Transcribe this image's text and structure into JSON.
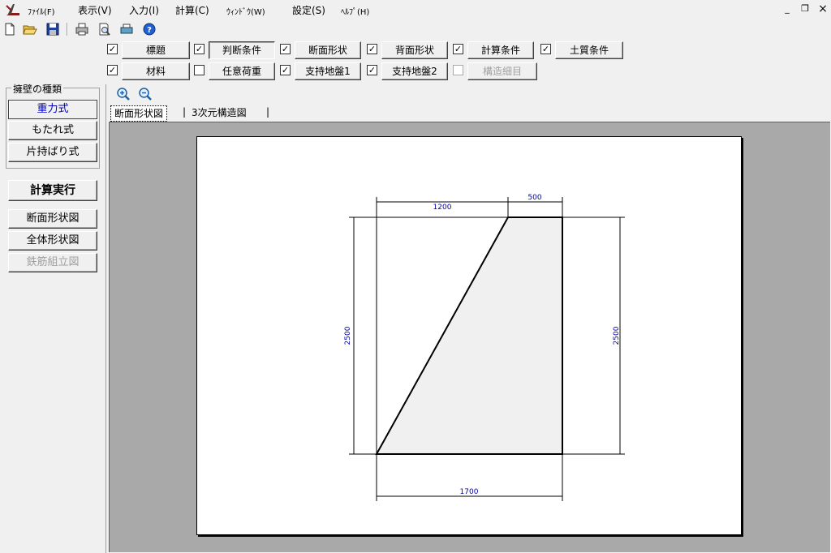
{
  "menu": {
    "file": "ﾌｧｲﾙ(F)",
    "view": "表示(V)",
    "input": "入力(I)",
    "calc": "計算(C)",
    "window": "ｳｨﾝﾄﾞｳ(W)",
    "settings": "設定(S)",
    "help": "ﾍﾙﾌﾟ(H)"
  },
  "window_controls": {
    "minimize": "_",
    "restore": "❐",
    "close": "×"
  },
  "toolbar_icons": [
    "new-file-icon",
    "open-folder-icon",
    "save-icon",
    "print-icon",
    "print-preview-icon",
    "printer-setup-icon",
    "help-icon"
  ],
  "options": {
    "row1": [
      {
        "label": "標題",
        "checked": true
      },
      {
        "label": "判断条件",
        "checked": true,
        "pressed": true
      },
      {
        "label": "断面形状",
        "checked": true
      },
      {
        "label": "背面形状",
        "checked": true
      },
      {
        "label": "計算条件",
        "checked": true
      },
      {
        "label": "土質条件",
        "checked": true
      }
    ],
    "row2": [
      {
        "label": "材料",
        "checked": true
      },
      {
        "label": "任意荷重",
        "checked": false
      },
      {
        "label": "支持地盤1",
        "checked": true
      },
      {
        "label": "支持地盤2",
        "checked": true
      },
      {
        "label": "構造細目",
        "checked": false,
        "disabled": true
      }
    ]
  },
  "wall_type": {
    "title": "擁壁の種類",
    "gravity": "重力式",
    "leaning": "もたれ式",
    "cantilever": "片持ばり式"
  },
  "actions": {
    "run_calc": "計算実行",
    "section_view": "断面形状図",
    "overall_view": "全体形状図",
    "rebar_view": "鉄筋組立図"
  },
  "tabs": [
    "断面形状図",
    "3次元構造図"
  ],
  "drawing": {
    "top_left_width": "1200",
    "top_width": "500",
    "left_height": "2500",
    "right_height": "2500",
    "base_width": "1700",
    "dim_color": "#0000a0"
  }
}
